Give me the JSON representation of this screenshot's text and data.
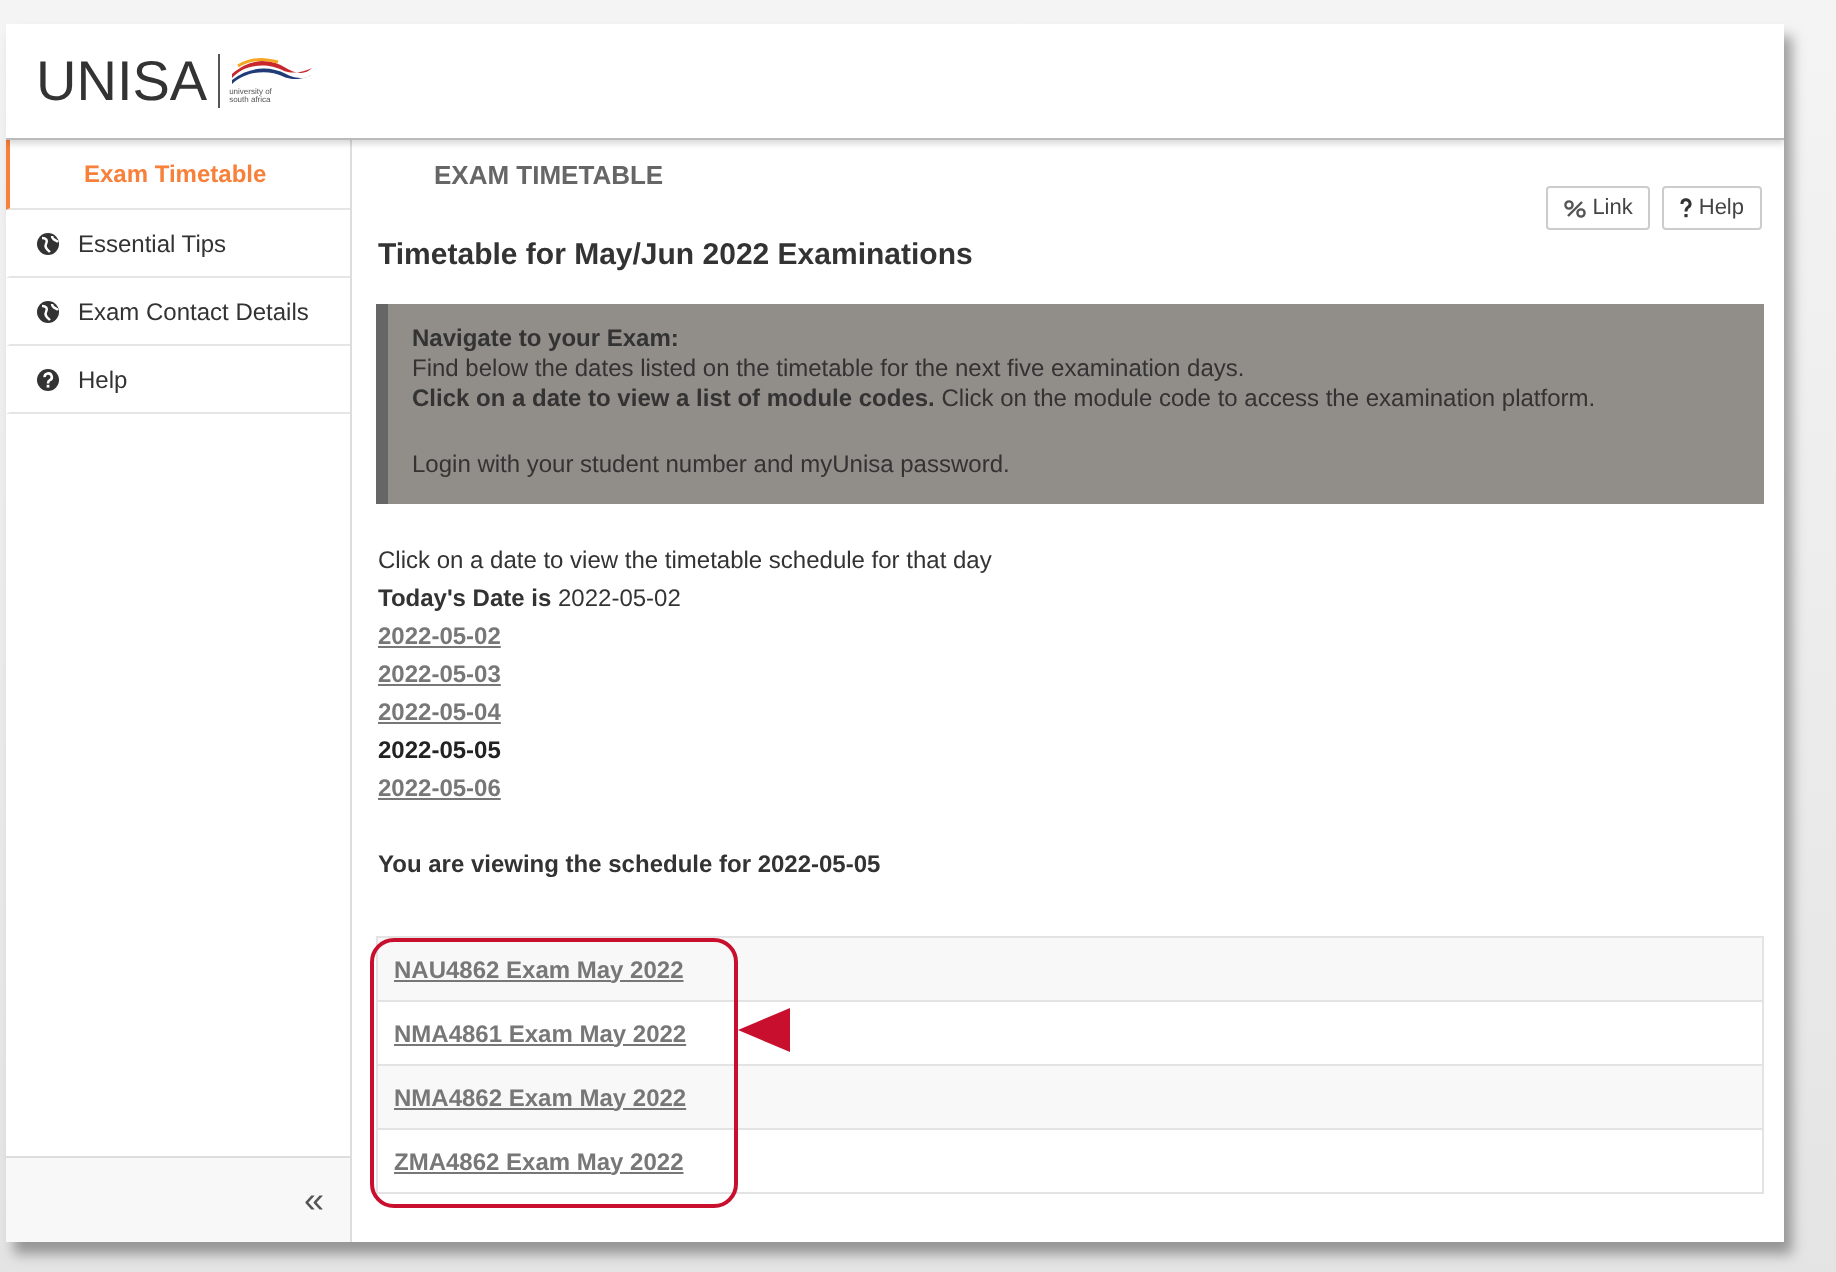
{
  "logo": {
    "wordmark": "UNISA",
    "tagline": "university of south africa"
  },
  "sidebar": {
    "items": [
      {
        "label": "Exam Timetable",
        "kind": "plain",
        "selected": true
      },
      {
        "label": "Essential Tips",
        "kind": "globe",
        "selected": false
      },
      {
        "label": "Exam Contact Details",
        "kind": "globe",
        "selected": false
      },
      {
        "label": "Help",
        "kind": "help",
        "selected": false
      }
    ],
    "collapse": "«"
  },
  "page_title": "EXAM TIMETABLE",
  "toolbar": [
    {
      "label": "Link",
      "kind": "link"
    },
    {
      "label": "Help",
      "kind": "help"
    }
  ],
  "heading": "Timetable for May/Jun 2022 Examinations",
  "notice": {
    "title": "Navigate to your Exam:",
    "lines": [
      "Find below the dates listed on the timetable for the next five examination days.",
      "**Click on a date to view a list of module codes.** Click on the module code to access the examination platform.",
      "Login with your student number and myUnisa password."
    ]
  },
  "intro": "Click on a date to view the timetable schedule for that day",
  "today": "**Today's Date is** 2022-05-02",
  "dates": [
    {
      "label": "2022-05-02",
      "selected": false
    },
    {
      "label": "2022-05-03",
      "selected": false
    },
    {
      "label": "2022-05-04",
      "selected": false
    },
    {
      "label": "2022-05-05",
      "selected": true
    },
    {
      "label": "2022-05-06",
      "selected": false
    }
  ],
  "viewing": "You are viewing the schedule for 2022-05-05",
  "modules": [
    "NAU4862 Exam May 2022",
    "NMA4861 Exam May 2022",
    "NMA4862 Exam May 2022",
    "ZMA4862 Exam May 2022"
  ]
}
